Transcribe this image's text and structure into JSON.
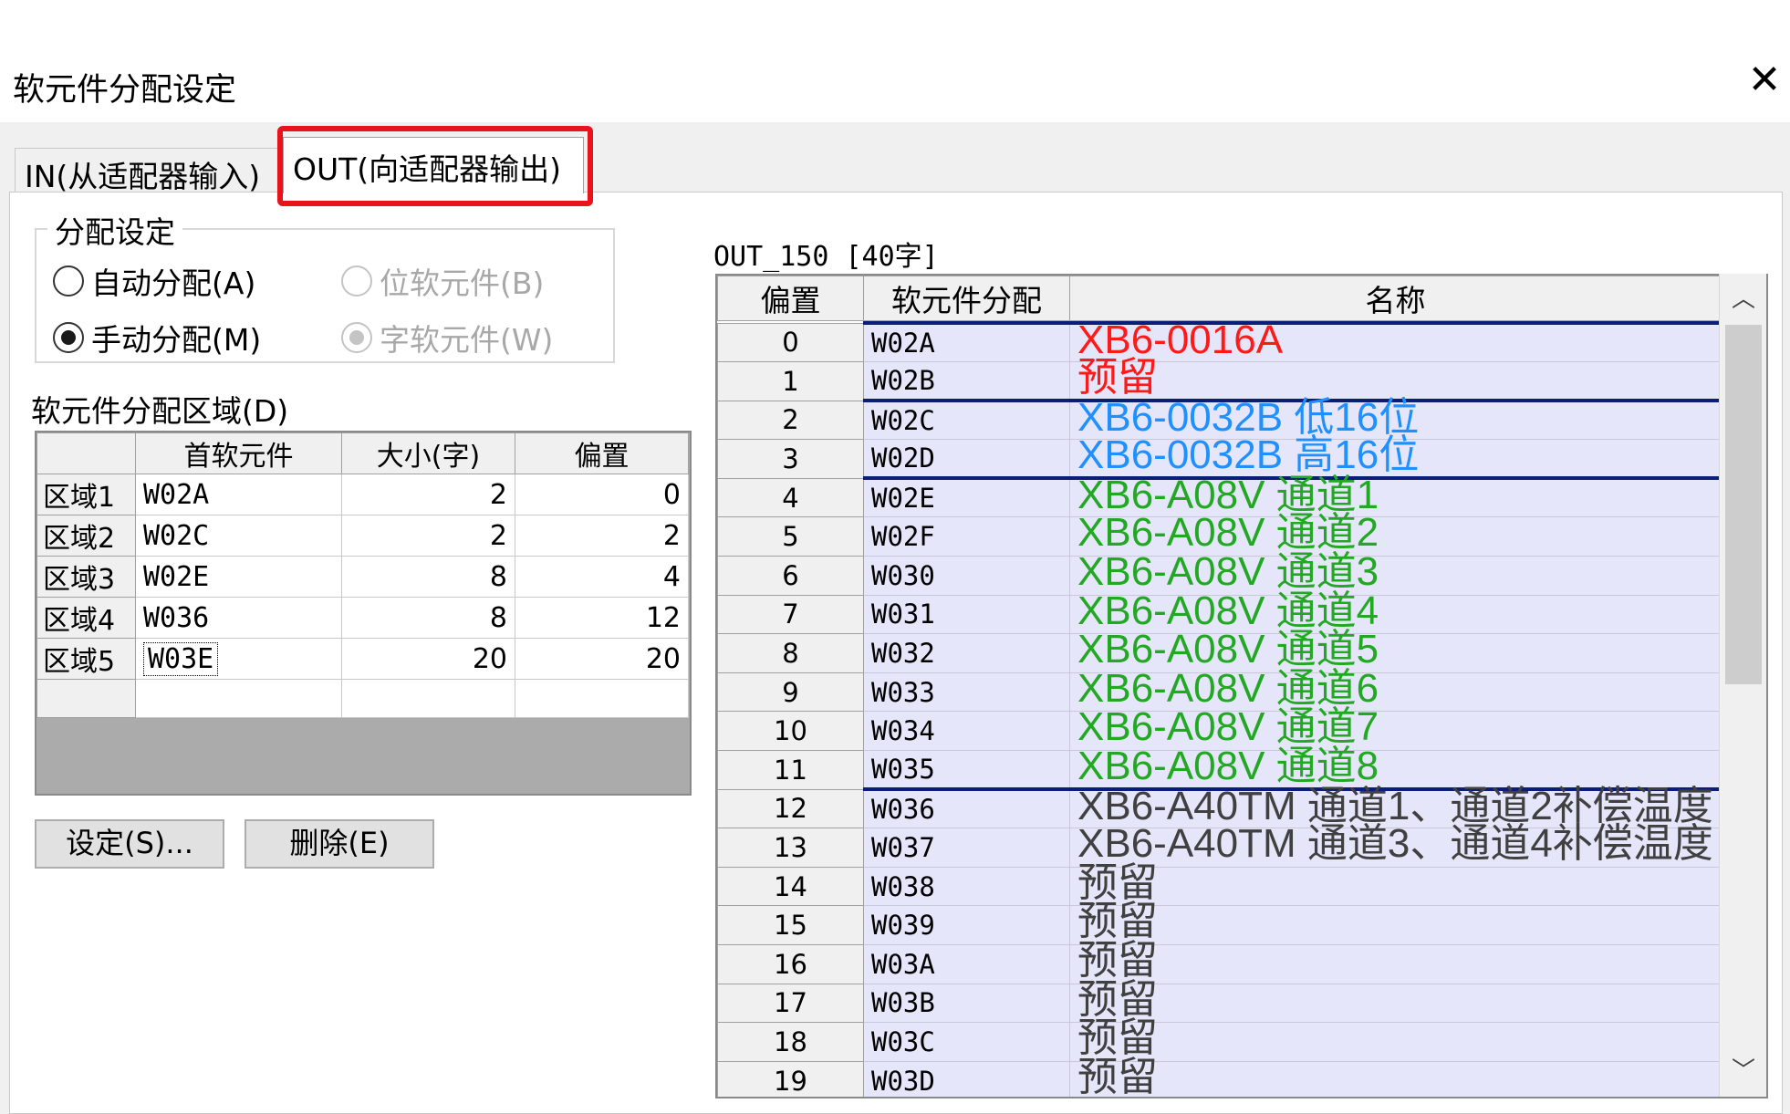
{
  "window": {
    "title": "软元件分配设定",
    "close_glyph": "✕"
  },
  "tabs": [
    {
      "label": "IN(从适配器输入)"
    },
    {
      "label": "OUT(向适配器输出)"
    }
  ],
  "allocation": {
    "legend": "分配设定",
    "auto": "自动分配(A)",
    "manual": "手动分配(M)",
    "bit": "位软元件(B)",
    "word": "字软元件(W)"
  },
  "area": {
    "label": "软元件分配区域(D)",
    "headers": [
      "首软元件",
      "大小(字)",
      "偏置"
    ],
    "rows": [
      {
        "name": "区域1",
        "device": "W02A",
        "size": "2",
        "offset": "0"
      },
      {
        "name": "区域2",
        "device": "W02C",
        "size": "2",
        "offset": "2"
      },
      {
        "name": "区域3",
        "device": "W02E",
        "size": "8",
        "offset": "4"
      },
      {
        "name": "区域4",
        "device": "W036",
        "size": "8",
        "offset": "12"
      },
      {
        "name": "区域5",
        "device": "W03E",
        "size": "20",
        "offset": "20"
      }
    ]
  },
  "buttons": {
    "set": "设定(S)...",
    "delete": "删除(E)"
  },
  "out": {
    "label": "OUT_150 [40字]",
    "headers": [
      "偏置",
      "软元件分配",
      "名称"
    ],
    "rows": [
      {
        "offset": "0",
        "device": "W02A",
        "name": "XB6-0016A",
        "color": "#ff1a1a",
        "sep": true
      },
      {
        "offset": "1",
        "device": "W02B",
        "name": "预留",
        "color": "#ff1a1a",
        "sep": false
      },
      {
        "offset": "2",
        "device": "W02C",
        "name": "XB6-0032B 低16位",
        "color": "#1e90ff",
        "sep": true
      },
      {
        "offset": "3",
        "device": "W02D",
        "name": "XB6-0032B 高16位",
        "color": "#1e90ff",
        "sep": false
      },
      {
        "offset": "4",
        "device": "W02E",
        "name": "XB6-A08V 通道1",
        "color": "#22a822",
        "sep": true
      },
      {
        "offset": "5",
        "device": "W02F",
        "name": "XB6-A08V 通道2",
        "color": "#22a822",
        "sep": false
      },
      {
        "offset": "6",
        "device": "W030",
        "name": "XB6-A08V 通道3",
        "color": "#22a822",
        "sep": false
      },
      {
        "offset": "7",
        "device": "W031",
        "name": "XB6-A08V 通道4",
        "color": "#22a822",
        "sep": false
      },
      {
        "offset": "8",
        "device": "W032",
        "name": "XB6-A08V 通道5",
        "color": "#22a822",
        "sep": false
      },
      {
        "offset": "9",
        "device": "W033",
        "name": "XB6-A08V 通道6",
        "color": "#22a822",
        "sep": false
      },
      {
        "offset": "10",
        "device": "W034",
        "name": "XB6-A08V 通道7",
        "color": "#22a822",
        "sep": false
      },
      {
        "offset": "11",
        "device": "W035",
        "name": "XB6-A08V 通道8",
        "color": "#22a822",
        "sep": false
      },
      {
        "offset": "12",
        "device": "W036",
        "name": "XB6-A40TM 通道1、通道2补偿温度",
        "color": "#404040",
        "sep": true
      },
      {
        "offset": "13",
        "device": "W037",
        "name": "XB6-A40TM 通道3、通道4补偿温度",
        "color": "#404040",
        "sep": false
      },
      {
        "offset": "14",
        "device": "W038",
        "name": "预留",
        "color": "#404040",
        "sep": false
      },
      {
        "offset": "15",
        "device": "W039",
        "name": "预留",
        "color": "#404040",
        "sep": false
      },
      {
        "offset": "16",
        "device": "W03A",
        "name": "预留",
        "color": "#404040",
        "sep": false
      },
      {
        "offset": "17",
        "device": "W03B",
        "name": "预留",
        "color": "#404040",
        "sep": false
      },
      {
        "offset": "18",
        "device": "W03C",
        "name": "预留",
        "color": "#404040",
        "sep": false
      },
      {
        "offset": "19",
        "device": "W03D",
        "name": "预留",
        "color": "#404040",
        "sep": false
      }
    ]
  },
  "scroll": {
    "up": "︿",
    "down": "﹀"
  }
}
